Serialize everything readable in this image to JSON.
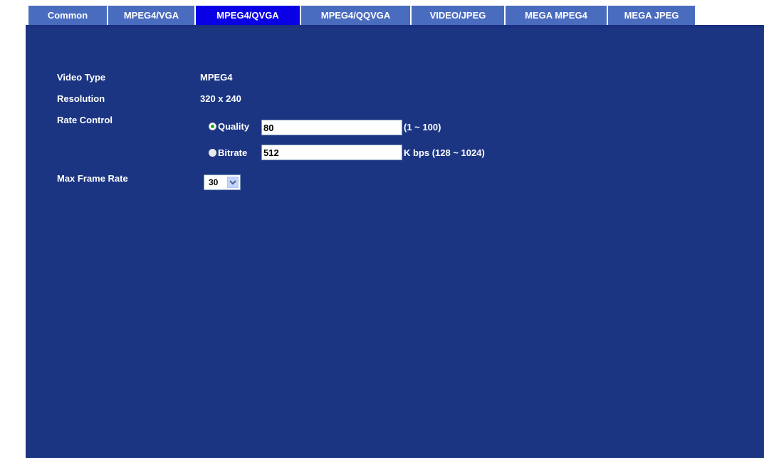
{
  "tabs": [
    {
      "label": "Common",
      "active": false
    },
    {
      "label": "MPEG4/VGA",
      "active": false
    },
    {
      "label": "MPEG4/QVGA",
      "active": true
    },
    {
      "label": "MPEG4/QQVGA",
      "active": false
    },
    {
      "label": "VIDEO/JPEG",
      "active": false
    },
    {
      "label": "MEGA MPEG4",
      "active": false
    },
    {
      "label": "MEGA JPEG",
      "active": false
    }
  ],
  "form": {
    "video_type_label": "Video Type",
    "video_type_value": "MPEG4",
    "resolution_label": "Resolution",
    "resolution_value": "320 x 240",
    "rate_control_label": "Rate Control",
    "quality_label": "Quality",
    "quality_value": "80",
    "quality_range": "(1 ~ 100)",
    "bitrate_label": "Bitrate",
    "bitrate_value": "512",
    "bitrate_range": "K bps (128 ~ 1024)",
    "rate_control_selected": "Quality",
    "max_frame_rate_label": "Max Frame Rate",
    "max_frame_rate_value": "30"
  },
  "colors": {
    "panel_bg": "#1b3582",
    "tab_bg": "#4a6cbf",
    "tab_active_bg": "#0a00e6",
    "text": "#ffffff",
    "radio_selected_dot": "#19a619"
  }
}
